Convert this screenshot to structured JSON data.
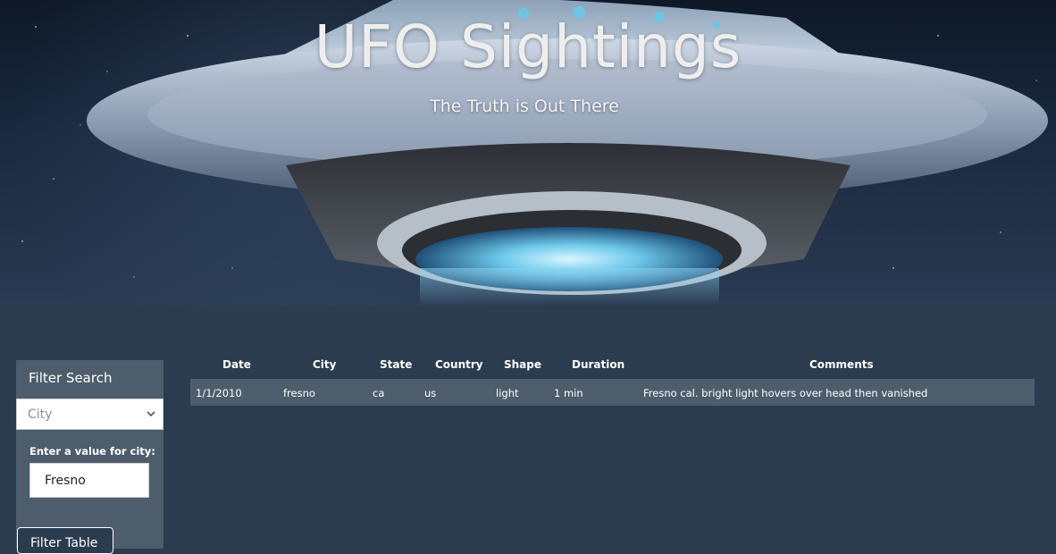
{
  "header": {
    "title": "UFO Sightings",
    "subtitle": "The Truth is Out There"
  },
  "filter": {
    "heading": "Filter Search",
    "select_value": "City",
    "input_label": "Enter a value for city:",
    "input_value": "Fresno",
    "button_label": "Filter Table"
  },
  "table": {
    "columns": [
      "Date",
      "City",
      "State",
      "Country",
      "Shape",
      "Duration",
      "Comments"
    ],
    "rows": [
      [
        "1/1/2010",
        "fresno",
        "ca",
        "us",
        "light",
        "1 min",
        "Fresno cal. bright light hovers over head then vanished"
      ]
    ]
  },
  "colors": {
    "page_background": "#2b3c4e",
    "panel_background": "#4e5d6c"
  }
}
